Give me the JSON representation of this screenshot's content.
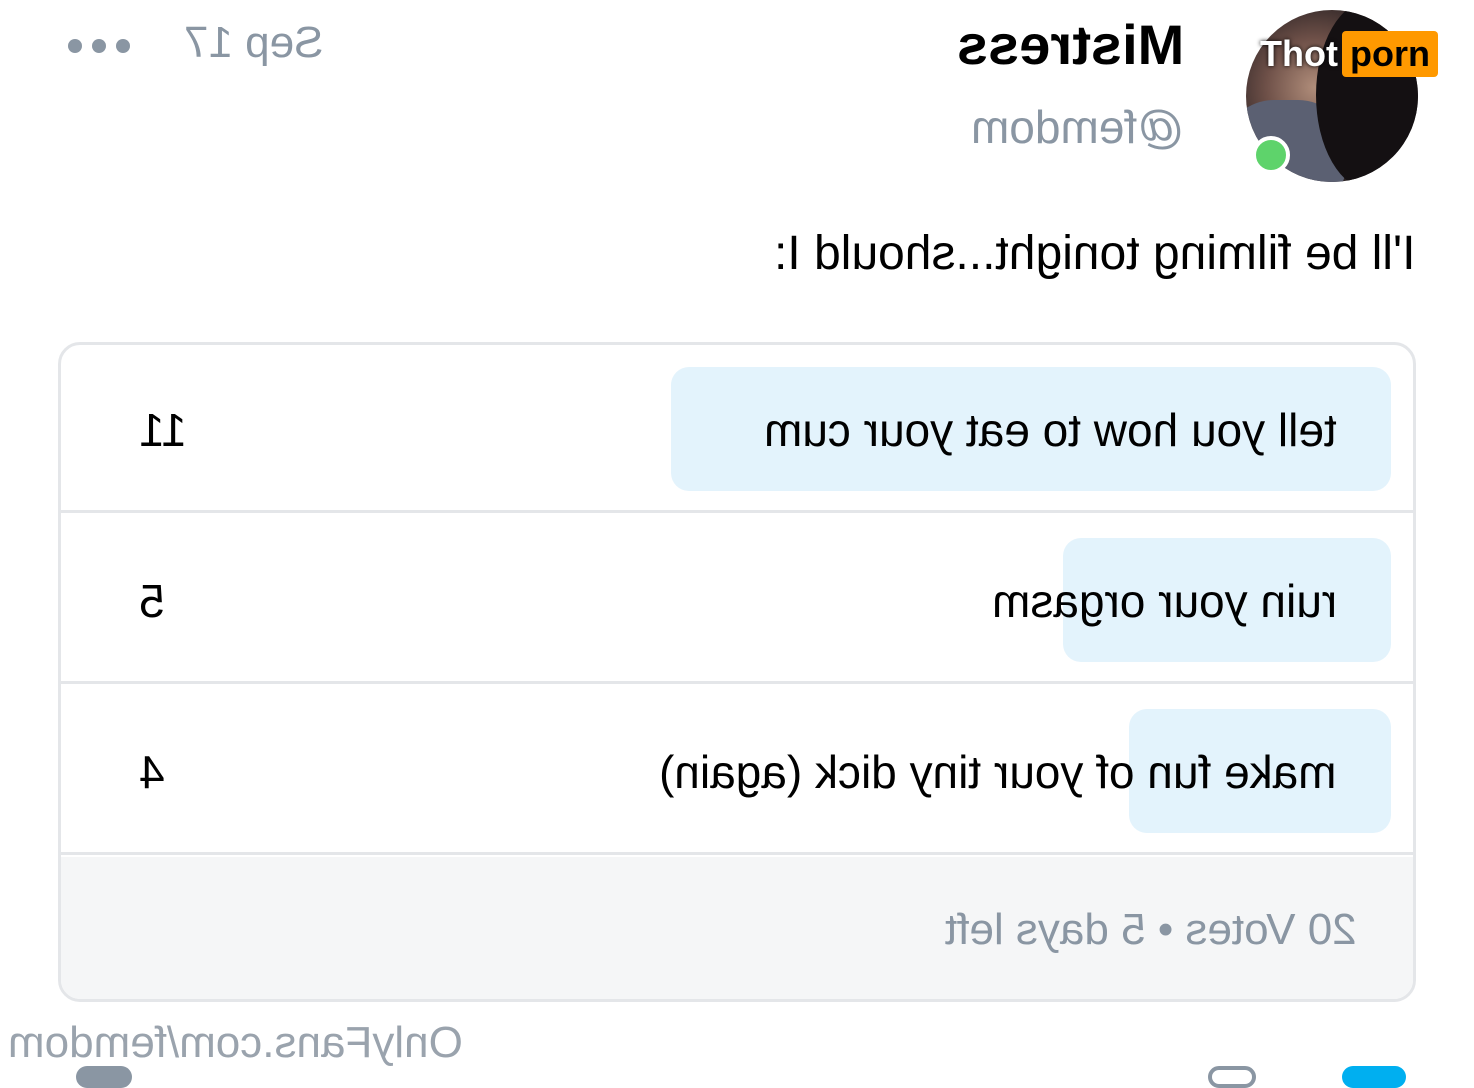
{
  "post": {
    "date": "Sep 17",
    "more_icon": "more-dots-icon",
    "author_name": "Mistress",
    "author_handle": "@femdom",
    "caption": "I'll be filming tonight...should I:"
  },
  "watermark": {
    "part1": "Thot",
    "part2": "porn",
    "colors": {
      "part2_bg": "#ff9900"
    }
  },
  "poll": {
    "options": [
      {
        "label": "tell you how to eat your cum",
        "votes": "11",
        "share": 0.55
      },
      {
        "label": "ruin your orgasm",
        "votes": "5",
        "share": 0.25
      },
      {
        "label": "make fun of your tiny dick (again)",
        "votes": "4",
        "share": 0.2
      }
    ],
    "footer": "20 Votes • 5 days left"
  },
  "source_text": "OnlyFans.com/femdom",
  "colors": {
    "bar": "#e3f3fc",
    "muted": "#8a96a3",
    "online": "#5ed36b"
  }
}
